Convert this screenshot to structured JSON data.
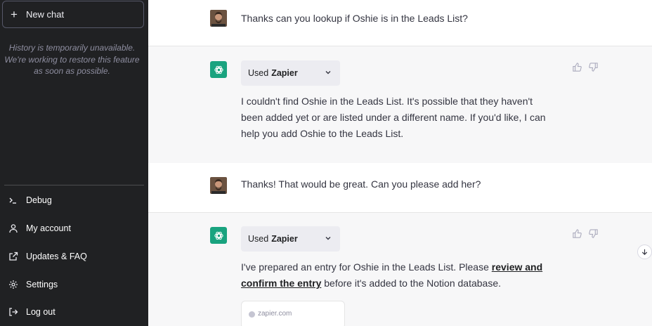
{
  "sidebar": {
    "new_chat": "New chat",
    "history_note": "History is temporarily unavailable. We're working to restore this feature as soon as possible.",
    "menu": [
      {
        "label": "Debug",
        "icon": "terminal-icon"
      },
      {
        "label": "My account",
        "icon": "user-icon"
      },
      {
        "label": "Updates & FAQ",
        "icon": "external-link-icon"
      },
      {
        "label": "Settings",
        "icon": "gear-icon"
      },
      {
        "label": "Log out",
        "icon": "logout-icon"
      }
    ]
  },
  "conversation": [
    {
      "role": "user",
      "text": "Thanks can you lookup if Oshie is in the Leads List?"
    },
    {
      "role": "assistant",
      "plugin_prefix": "Used",
      "plugin_name": "Zapier",
      "text": "I couldn't find Oshie in the Leads List. It's possible that they haven't been added yet or are listed under a different name. If you'd like, I can help you add Oshie to the Leads List."
    },
    {
      "role": "user",
      "text": "Thanks! That would be great. Can you please add her?"
    },
    {
      "role": "assistant",
      "plugin_prefix": "Used",
      "plugin_name": "Zapier",
      "text_before": "I've prepared an entry for Oshie in the Leads List. Please",
      "link_text": "review and confirm the entry",
      "text_after": "before it's added to the Notion database."
    }
  ],
  "link_card": {
    "domain": "zapier.com"
  },
  "colors": {
    "sidebar_bg": "#202123",
    "assistant_bg": "#f7f7f8",
    "gpt_green": "#19a37f"
  }
}
